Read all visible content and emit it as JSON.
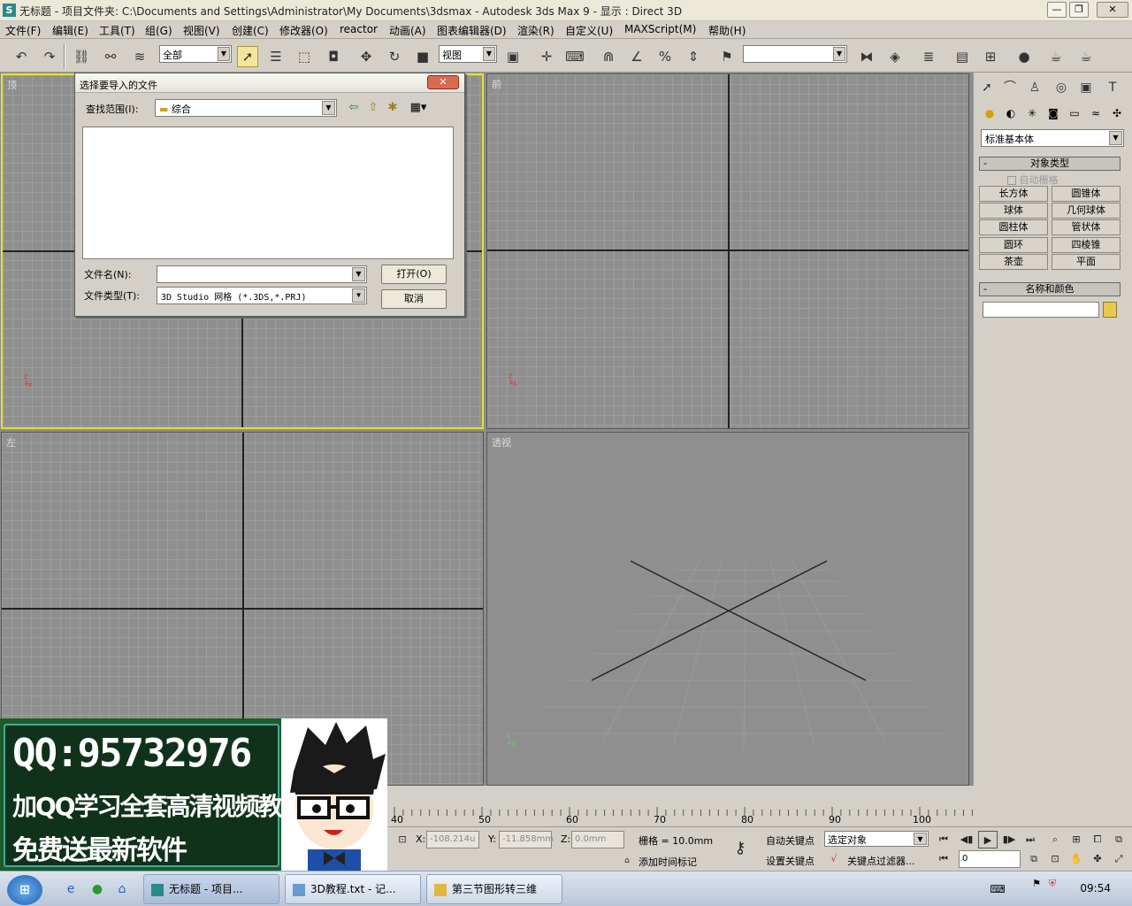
{
  "window": {
    "title": "无标题      - 项目文件夹: C:\\Documents and Settings\\Administrator\\My Documents\\3dsmax      - Autodesk 3ds Max 9      - 显示 : Direct 3D",
    "minimize": "—",
    "restore": "❐",
    "close": "✕"
  },
  "menu": [
    "文件(F)",
    "编辑(E)",
    "工具(T)",
    "组(G)",
    "视图(V)",
    "创建(C)",
    "修改器(O)",
    "reactor",
    "动画(A)",
    "图表编辑器(D)",
    "渲染(R)",
    "自定义(U)",
    "MAXScript(M)",
    "帮助(H)"
  ],
  "toolbar": {
    "selection_filter": "全部",
    "ref_coord": "视图",
    "named_selection": ""
  },
  "viewports": {
    "top": "顶",
    "front": "前",
    "left": "左",
    "perspective": "透视"
  },
  "dialog": {
    "title": "选择要导入的文件",
    "look_in_label": "查找范围(I):",
    "look_in_value": "综合",
    "filename_label": "文件名(N):",
    "filename_value": "",
    "filetype_label": "文件类型(T):",
    "filetype_value": "3D Studio 网格 (*.3DS,*.PRJ)",
    "open_button": "打开(O)",
    "cancel_button": "取消",
    "close": "✕"
  },
  "command_panel": {
    "category": "标准基本体",
    "object_type_header": "对象类型",
    "autogrid": "自动栅格",
    "objects": [
      "长方体",
      "圆锥体",
      "球体",
      "几何球体",
      "圆柱体",
      "管状体",
      "圆环",
      "四棱锥",
      "茶壶",
      "平面"
    ],
    "name_color_header": "名称和颜色",
    "name_value": "",
    "color": "#e8c850"
  },
  "promo": {
    "qq": "QQ:95732976",
    "line1": "加QQ学习全套高清视频教程",
    "line2": "免费送最新软件"
  },
  "timeline": {
    "ticks": [
      "40",
      "50",
      "60",
      "70",
      "80",
      "90",
      "100"
    ]
  },
  "status": {
    "x_label": "X:",
    "x_value": "-108.214u",
    "y_label": "Y:",
    "y_value": "-11.858mm",
    "z_label": "Z:",
    "z_value": "0.0mm",
    "grid": "栅格 = 10.0mm",
    "add_time_tag": "添加时间标记",
    "auto_key": "自动关键点",
    "set_key": "设置关键点",
    "selected": "选定对象",
    "key_filters": "关键点过滤器...",
    "frame": "0"
  },
  "taskbar": {
    "tasks": [
      "无标题      - 项目...",
      "3D教程.txt - 记...",
      "第三节图形转三维"
    ],
    "clock": "09:54"
  }
}
